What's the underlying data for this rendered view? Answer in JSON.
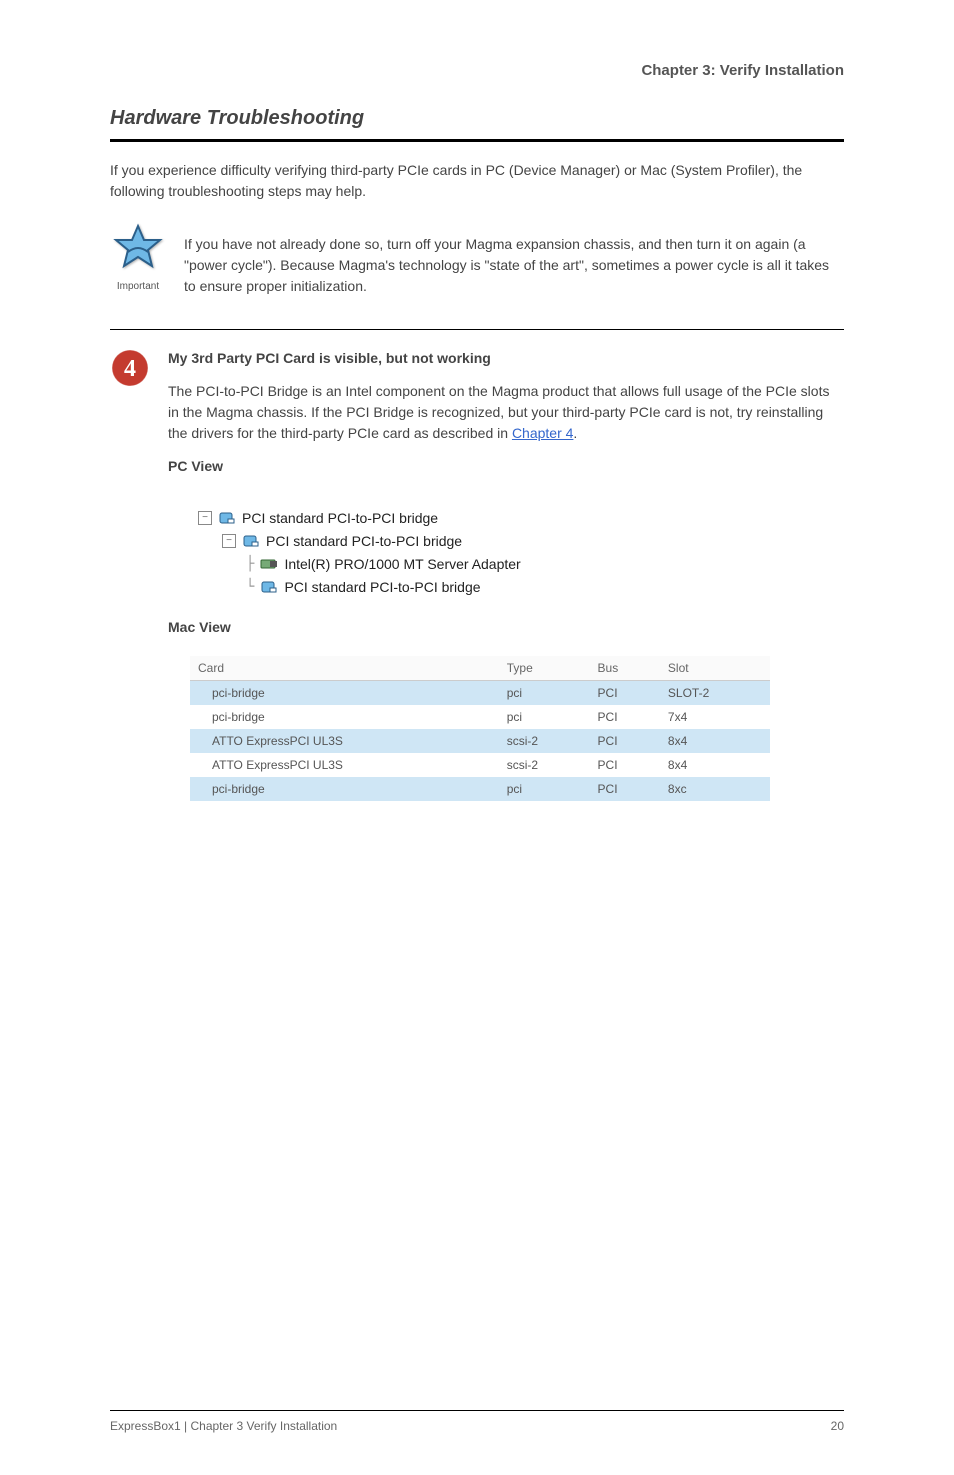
{
  "header": {
    "chapter": "Chapter 3: Verify Installation"
  },
  "trouble": {
    "title": "Hardware Troubleshooting",
    "intro": "If you experience difficulty verifying third-party PCIe cards in PC (Device Manager) or Mac (System Profiler), the following troubleshooting steps may help.",
    "note": "If you have not already done so, turn off your Magma expansion chassis, and then turn it on again (a \"power cycle\"). Because Magma's technology is \"state of the art\", sometimes a power cycle is all it takes to ensure proper initialization.",
    "step4_label": "My 3rd Party PCI Card is visible, but not working",
    "step4_body1": "The PCI-to-PCI Bridge is an Intel component on the Magma product that allows full usage of the PCIe slots in the Magma chassis. If the PCI Bridge is recognized, but your third-party PCIe card is not, try reinstalling the drivers for the third-party PCIe card as described in ",
    "step4_link": "Chapter 4",
    "step4_body2": ".",
    "pc_view_label": "PC View",
    "mac_view_label": "Mac View"
  },
  "tree": {
    "n1": "PCI standard PCI-to-PCI bridge",
    "n2": "PCI standard PCI-to-PCI bridge",
    "n3": "Intel(R) PRO/1000 MT Server Adapter",
    "n4": "PCI standard PCI-to-PCI bridge"
  },
  "table": {
    "headers": {
      "card": "Card",
      "type": "Type",
      "bus": "Bus",
      "slot": "Slot"
    },
    "rows": [
      {
        "card": "pci-bridge",
        "type": "pci",
        "bus": "PCI",
        "slot": "SLOT-2",
        "hl": true
      },
      {
        "card": "pci-bridge",
        "type": "pci",
        "bus": "PCI",
        "slot": "7x4",
        "hl": false
      },
      {
        "card": "ATTO ExpressPCI UL3S",
        "type": "scsi-2",
        "bus": "PCI",
        "slot": "8x4",
        "hl": true
      },
      {
        "card": "ATTO ExpressPCI UL3S",
        "type": "scsi-2",
        "bus": "PCI",
        "slot": "8x4",
        "hl": false
      },
      {
        "card": "pci-bridge",
        "type": "pci",
        "bus": "PCI",
        "slot": "8xc",
        "hl": true
      }
    ]
  },
  "footer": {
    "left": "ExpressBox1 | Chapter 3   Verify Installation",
    "right": "20"
  },
  "icons": {
    "important": "Important"
  }
}
